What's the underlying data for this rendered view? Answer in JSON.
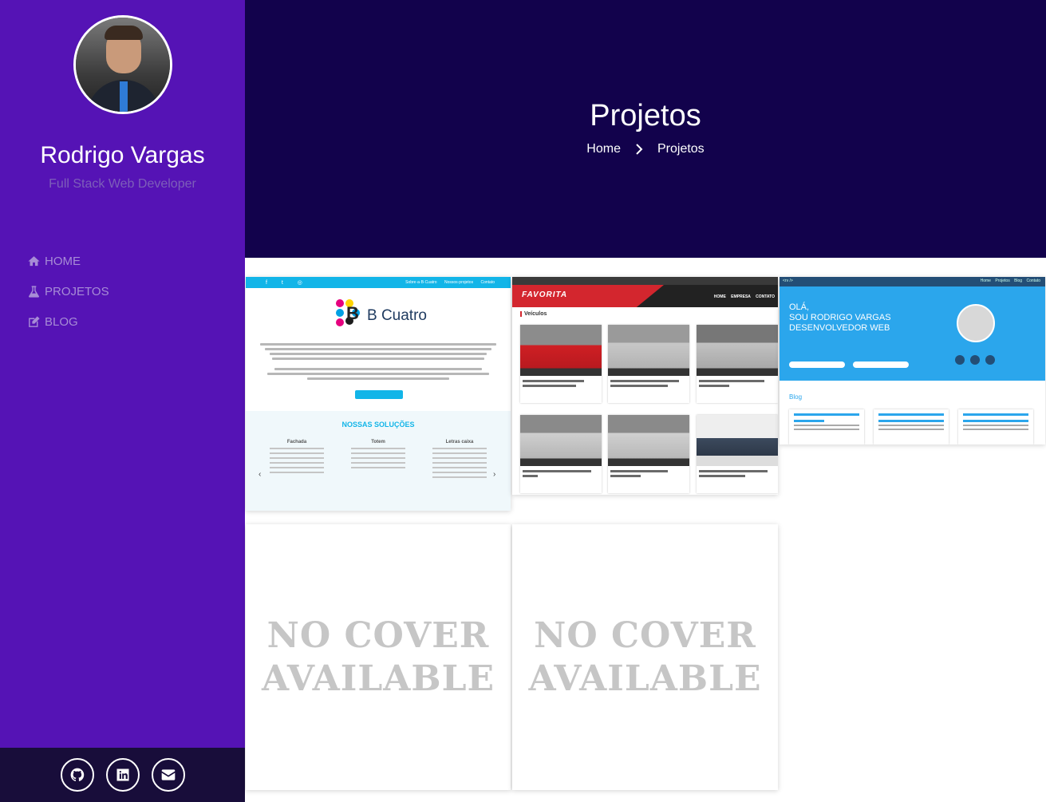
{
  "profile": {
    "name": "Rodrigo Vargas",
    "role": "Full Stack Web Developer"
  },
  "nav": [
    {
      "label": "HOME",
      "icon": "home-icon"
    },
    {
      "label": "PROJETOS",
      "icon": "flask-icon"
    },
    {
      "label": "BLOG",
      "icon": "edit-icon"
    }
  ],
  "social": [
    {
      "icon": "github-icon"
    },
    {
      "icon": "linkedin-icon"
    },
    {
      "icon": "envelope-icon"
    }
  ],
  "header": {
    "title": "Projetos",
    "breadcrumb": [
      "Home",
      "Projetos"
    ]
  },
  "projects": [
    {
      "type": "screenshot",
      "screen": {
        "brand": "B Cuatro",
        "section_title": "NOSSAS SOLUÇÕES",
        "columns": [
          "Fachada",
          "Totem",
          "Letras caixa"
        ]
      }
    },
    {
      "type": "screenshot",
      "screen": {
        "brand": "FAVORITA",
        "menu": "HOME EMPRESA CONTATO",
        "section": "Veículos"
      }
    },
    {
      "type": "screenshot",
      "screen": {
        "hero_text": [
          "OLÁ,",
          "SOU RODRIGO VARGAS",
          "DESENVOLVEDOR WEB"
        ],
        "blog_title": "Blog"
      }
    },
    {
      "type": "no-cover",
      "cover_text": [
        "NO COVER",
        "AVAILABLE"
      ]
    },
    {
      "type": "no-cover",
      "cover_text": [
        "NO COVER",
        "AVAILABLE"
      ]
    }
  ],
  "colors": {
    "sidebar": "#5513b5",
    "header": "#12024c",
    "social_bar": "#180d3a",
    "nav_text": "#a78cd6"
  }
}
